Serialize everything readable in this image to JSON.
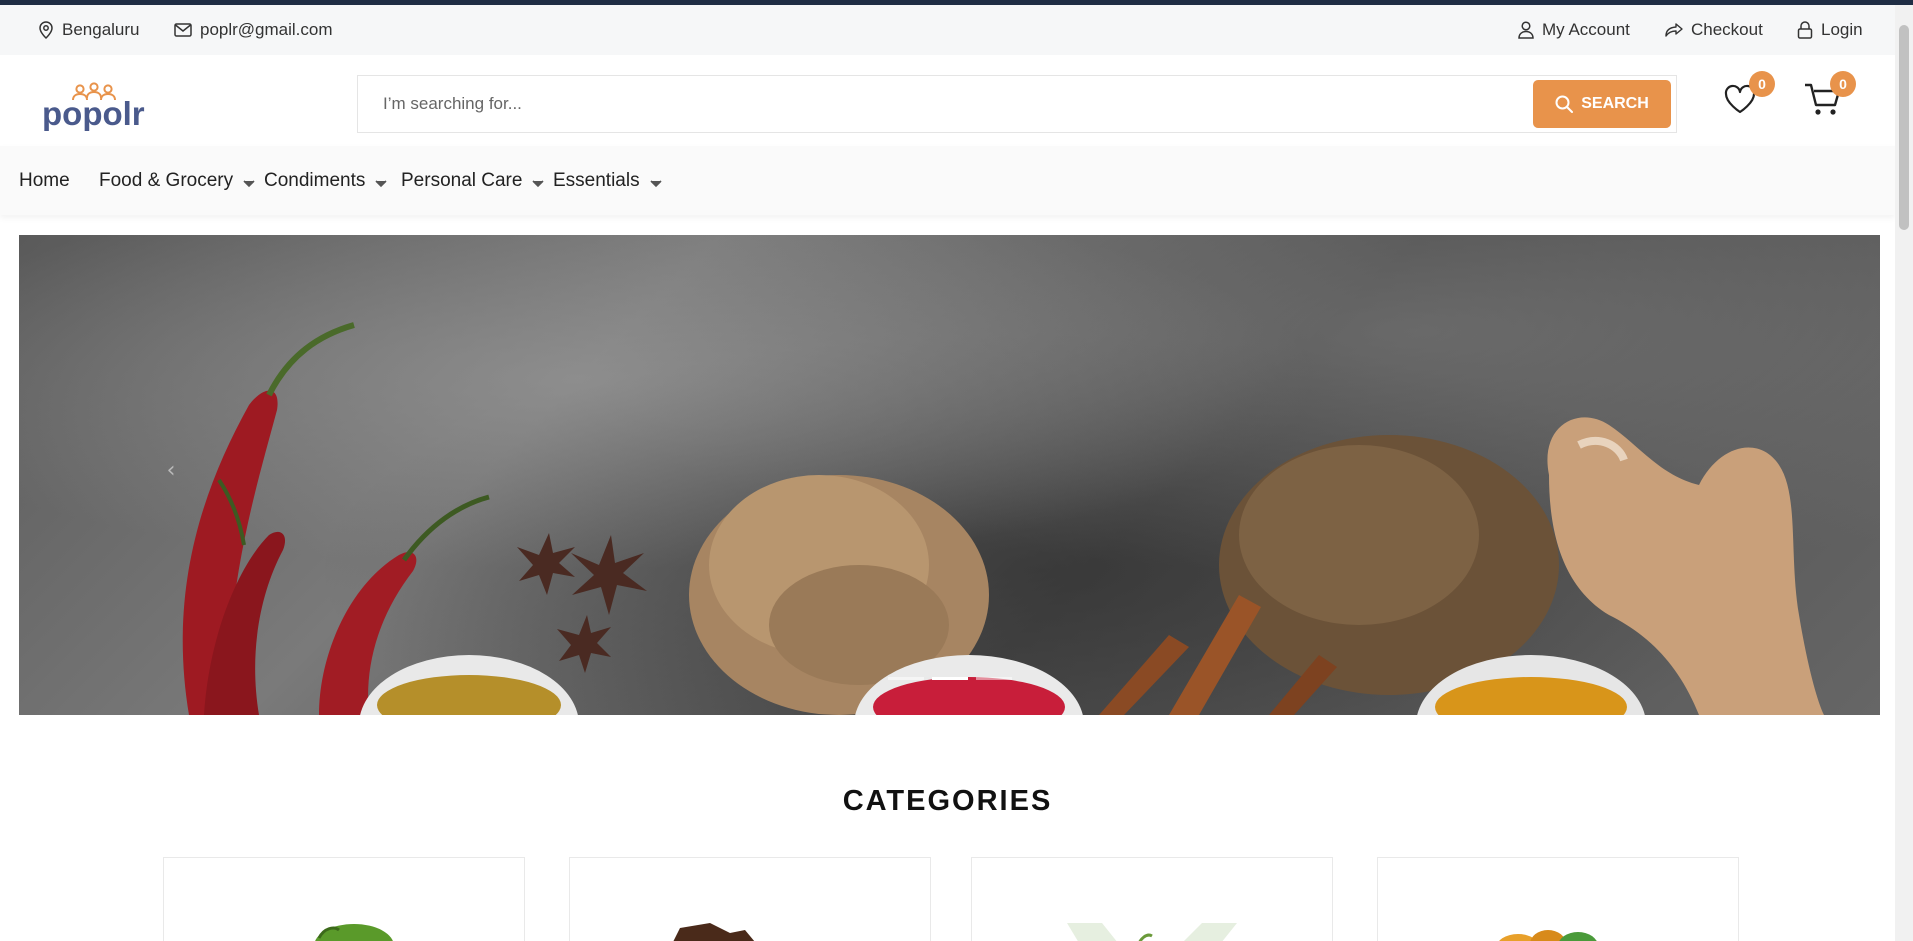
{
  "topbar": {
    "location": "Bengaluru",
    "email": "poplr@gmail.com",
    "my_account": "My Account",
    "checkout": "Checkout",
    "login": "Login"
  },
  "header": {
    "logo_text": "popolr",
    "search_placeholder": "I’m searching for...",
    "search_button": "SEARCH",
    "wishlist_count": "0",
    "cart_count": "0"
  },
  "nav": {
    "items": [
      {
        "label": "Home"
      },
      {
        "label": "Food & Grocery"
      },
      {
        "label": "Condiments"
      },
      {
        "label": "Personal Care"
      },
      {
        "label": "Essentials"
      }
    ]
  },
  "hero": {
    "prev_arrow": "‹",
    "slide_count": 3,
    "active_slide": 1
  },
  "categories": {
    "title": "CATEGORIES"
  },
  "colors": {
    "accent": "#e8934b",
    "logo_blue": "#4a5a8c",
    "top_strip": "#1f2d44"
  }
}
